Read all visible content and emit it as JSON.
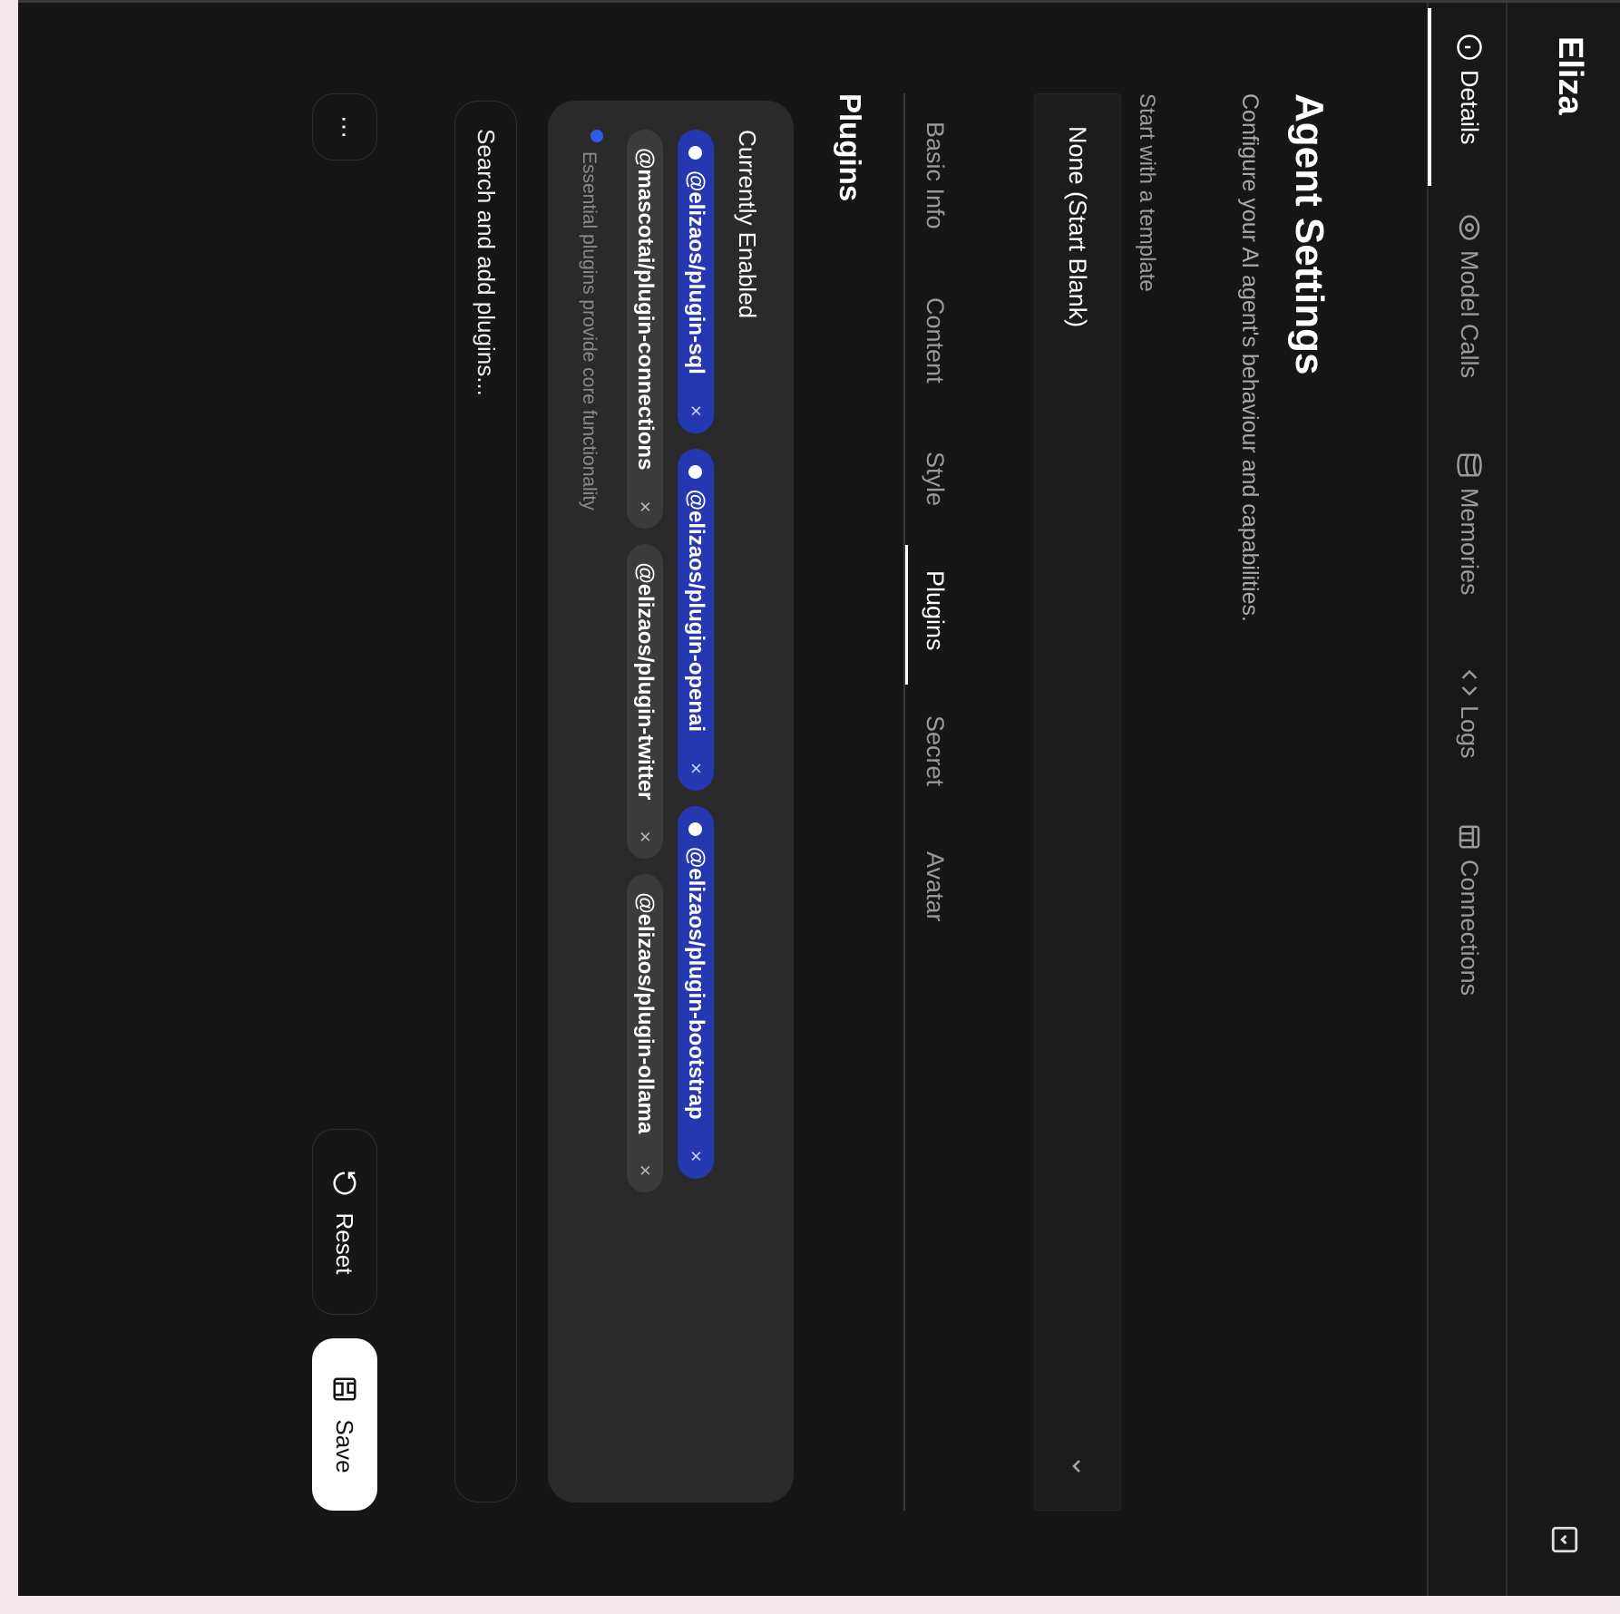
{
  "header": {
    "agent_name": "Eliza"
  },
  "nav_tabs": [
    {
      "label": "Details",
      "icon": "info-icon",
      "active": true
    },
    {
      "label": "Model Calls",
      "icon": "eye-icon",
      "active": false
    },
    {
      "label": "Memories",
      "icon": "database-icon",
      "active": false
    },
    {
      "label": "Logs",
      "icon": "code-icon",
      "active": false
    },
    {
      "label": "Connections",
      "icon": "table-icon",
      "active": false
    }
  ],
  "page": {
    "title": "Agent Settings",
    "subtitle": "Configure your AI agent's behaviour and capabilities."
  },
  "template": {
    "label": "Start with a template",
    "selected": "None (Start Blank)"
  },
  "sub_tabs": [
    {
      "label": "Basic Info"
    },
    {
      "label": "Content"
    },
    {
      "label": "Style"
    },
    {
      "label": "Plugins",
      "active": true
    },
    {
      "label": "Secret"
    },
    {
      "label": "Avatar"
    }
  ],
  "plugins": {
    "heading": "Plugins",
    "enabled_label": "Currently Enabled",
    "enabled": [
      {
        "name": "@elizaos/plugin-sql",
        "essential": true
      },
      {
        "name": "@elizaos/plugin-openai",
        "essential": true
      },
      {
        "name": "@elizaos/plugin-bootstrap",
        "essential": true
      },
      {
        "name": "@mascotai/plugin-connections",
        "essential": false
      },
      {
        "name": "@elizaos/plugin-twitter",
        "essential": false
      },
      {
        "name": "@elizaos/plugin-ollama",
        "essential": false
      }
    ],
    "remove_glyph": "×",
    "note": "Essential plugins provide core functionality",
    "search_placeholder": "Search and add plugins..."
  },
  "actions": {
    "more": "⋯",
    "reset": "Reset",
    "save": "Save"
  },
  "colors": {
    "essential_chip": "#2338b1",
    "optional_chip": "#3b3b3b",
    "background": "#161616"
  }
}
